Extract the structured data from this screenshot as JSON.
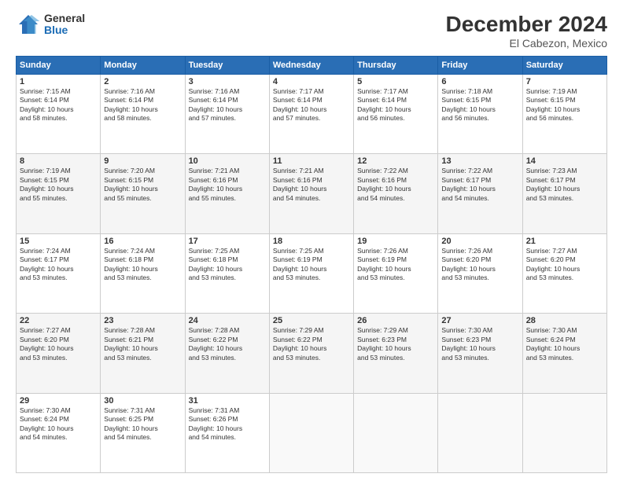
{
  "logo": {
    "general": "General",
    "blue": "Blue"
  },
  "header": {
    "month_title": "December 2024",
    "location": "El Cabezon, Mexico"
  },
  "weekdays": [
    "Sunday",
    "Monday",
    "Tuesday",
    "Wednesday",
    "Thursday",
    "Friday",
    "Saturday"
  ],
  "weeks": [
    [
      {
        "day": 1,
        "sunrise": "7:15 AM",
        "sunset": "6:14 PM",
        "daylight": "10 hours and 58 minutes."
      },
      {
        "day": 2,
        "sunrise": "7:16 AM",
        "sunset": "6:14 PM",
        "daylight": "10 hours and 58 minutes."
      },
      {
        "day": 3,
        "sunrise": "7:16 AM",
        "sunset": "6:14 PM",
        "daylight": "10 hours and 57 minutes."
      },
      {
        "day": 4,
        "sunrise": "7:17 AM",
        "sunset": "6:14 PM",
        "daylight": "10 hours and 57 minutes."
      },
      {
        "day": 5,
        "sunrise": "7:17 AM",
        "sunset": "6:14 PM",
        "daylight": "10 hours and 56 minutes."
      },
      {
        "day": 6,
        "sunrise": "7:18 AM",
        "sunset": "6:15 PM",
        "daylight": "10 hours and 56 minutes."
      },
      {
        "day": 7,
        "sunrise": "7:19 AM",
        "sunset": "6:15 PM",
        "daylight": "10 hours and 56 minutes."
      }
    ],
    [
      {
        "day": 8,
        "sunrise": "7:19 AM",
        "sunset": "6:15 PM",
        "daylight": "10 hours and 55 minutes."
      },
      {
        "day": 9,
        "sunrise": "7:20 AM",
        "sunset": "6:15 PM",
        "daylight": "10 hours and 55 minutes."
      },
      {
        "day": 10,
        "sunrise": "7:21 AM",
        "sunset": "6:16 PM",
        "daylight": "10 hours and 55 minutes."
      },
      {
        "day": 11,
        "sunrise": "7:21 AM",
        "sunset": "6:16 PM",
        "daylight": "10 hours and 54 minutes."
      },
      {
        "day": 12,
        "sunrise": "7:22 AM",
        "sunset": "6:16 PM",
        "daylight": "10 hours and 54 minutes."
      },
      {
        "day": 13,
        "sunrise": "7:22 AM",
        "sunset": "6:17 PM",
        "daylight": "10 hours and 54 minutes."
      },
      {
        "day": 14,
        "sunrise": "7:23 AM",
        "sunset": "6:17 PM",
        "daylight": "10 hours and 53 minutes."
      }
    ],
    [
      {
        "day": 15,
        "sunrise": "7:24 AM",
        "sunset": "6:17 PM",
        "daylight": "10 hours and 53 minutes."
      },
      {
        "day": 16,
        "sunrise": "7:24 AM",
        "sunset": "6:18 PM",
        "daylight": "10 hours and 53 minutes."
      },
      {
        "day": 17,
        "sunrise": "7:25 AM",
        "sunset": "6:18 PM",
        "daylight": "10 hours and 53 minutes."
      },
      {
        "day": 18,
        "sunrise": "7:25 AM",
        "sunset": "6:19 PM",
        "daylight": "10 hours and 53 minutes."
      },
      {
        "day": 19,
        "sunrise": "7:26 AM",
        "sunset": "6:19 PM",
        "daylight": "10 hours and 53 minutes."
      },
      {
        "day": 20,
        "sunrise": "7:26 AM",
        "sunset": "6:20 PM",
        "daylight": "10 hours and 53 minutes."
      },
      {
        "day": 21,
        "sunrise": "7:27 AM",
        "sunset": "6:20 PM",
        "daylight": "10 hours and 53 minutes."
      }
    ],
    [
      {
        "day": 22,
        "sunrise": "7:27 AM",
        "sunset": "6:20 PM",
        "daylight": "10 hours and 53 minutes."
      },
      {
        "day": 23,
        "sunrise": "7:28 AM",
        "sunset": "6:21 PM",
        "daylight": "10 hours and 53 minutes."
      },
      {
        "day": 24,
        "sunrise": "7:28 AM",
        "sunset": "6:22 PM",
        "daylight": "10 hours and 53 minutes."
      },
      {
        "day": 25,
        "sunrise": "7:29 AM",
        "sunset": "6:22 PM",
        "daylight": "10 hours and 53 minutes."
      },
      {
        "day": 26,
        "sunrise": "7:29 AM",
        "sunset": "6:23 PM",
        "daylight": "10 hours and 53 minutes."
      },
      {
        "day": 27,
        "sunrise": "7:30 AM",
        "sunset": "6:23 PM",
        "daylight": "10 hours and 53 minutes."
      },
      {
        "day": 28,
        "sunrise": "7:30 AM",
        "sunset": "6:24 PM",
        "daylight": "10 hours and 53 minutes."
      }
    ],
    [
      {
        "day": 29,
        "sunrise": "7:30 AM",
        "sunset": "6:24 PM",
        "daylight": "10 hours and 54 minutes."
      },
      {
        "day": 30,
        "sunrise": "7:31 AM",
        "sunset": "6:25 PM",
        "daylight": "10 hours and 54 minutes."
      },
      {
        "day": 31,
        "sunrise": "7:31 AM",
        "sunset": "6:26 PM",
        "daylight": "10 hours and 54 minutes."
      },
      null,
      null,
      null,
      null
    ]
  ],
  "labels": {
    "sunrise": "Sunrise:",
    "sunset": "Sunset:",
    "daylight": "Daylight:"
  }
}
